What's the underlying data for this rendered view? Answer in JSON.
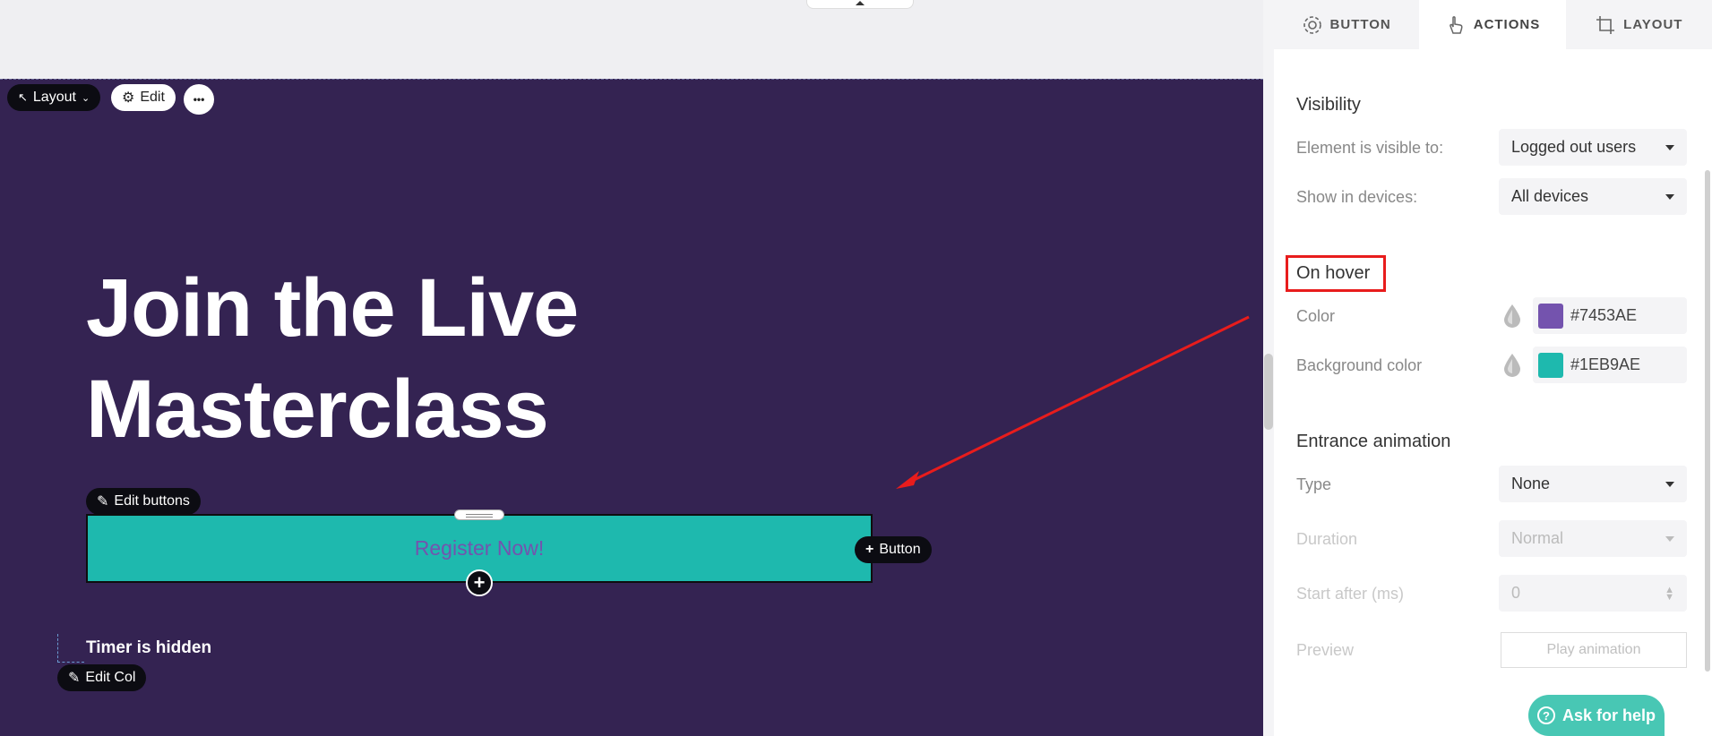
{
  "canvas": {
    "toolbar": {
      "layout_label": "Layout",
      "edit_label": "Edit",
      "more_label": "•••"
    },
    "headline_line1": "Join the Live",
    "headline_line2": "Masterclass",
    "edit_buttons_label": "Edit buttons",
    "register_button_label": "Register Now!",
    "add_button_label": "Button",
    "add_below_label": "+",
    "timer_text": "Timer is hidden",
    "edit_col_label": "Edit Col"
  },
  "panel": {
    "tabs": [
      {
        "label": "BUTTON",
        "icon": "gear-icon"
      },
      {
        "label": "ACTIONS",
        "icon": "pointer-hand-icon"
      },
      {
        "label": "LAYOUT",
        "icon": "crop-icon"
      }
    ],
    "visibility": {
      "title": "Visibility",
      "visible_to_label": "Element is visible to:",
      "visible_to_value": "Logged out users",
      "devices_label": "Show in devices:",
      "devices_value": "All devices"
    },
    "on_hover": {
      "title": "On hover",
      "color_label": "Color",
      "color_value": "#7453AE",
      "bg_label": "Background color",
      "bg_value": "#1EB9AE"
    },
    "entrance": {
      "title": "Entrance animation",
      "type_label": "Type",
      "type_value": "None",
      "duration_label": "Duration",
      "duration_value": "Normal",
      "start_label": "Start after (ms)",
      "start_value": "0",
      "preview_label": "Preview",
      "play_label": "Play animation"
    },
    "help_label": "Ask for help"
  },
  "colors": {
    "section_bg": "#342352",
    "button_bg": "#1EB9AE",
    "button_text": "#7453AE",
    "highlight": "#E81C1C"
  }
}
